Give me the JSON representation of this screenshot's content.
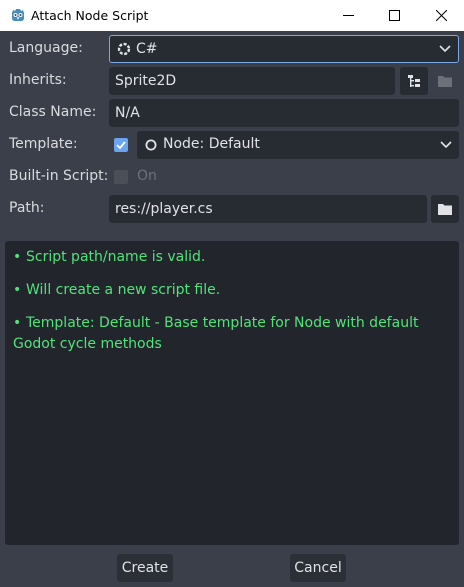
{
  "window": {
    "title": "Attach Node Script",
    "icon": "godot-icon",
    "controls": [
      "minimize-icon",
      "maximize-icon",
      "close-icon"
    ]
  },
  "form": {
    "language": {
      "label": "Language:",
      "value": "C#",
      "icon": "csharp-icon"
    },
    "inherits": {
      "label": "Inherits:",
      "value": "Sprite2D"
    },
    "class_name": {
      "label": "Class Name:",
      "value": "N/A"
    },
    "template": {
      "label": "Template:",
      "checked": true,
      "value": "Node: Default"
    },
    "builtin": {
      "label": "Built-in Script:",
      "checked": false,
      "disabled": true,
      "value": "On"
    },
    "path": {
      "label": "Path:",
      "value": "res://player.cs"
    }
  },
  "messages": [
    "Script path/name is valid.",
    "Will create a new script file.",
    "Template: Default - Base template for Node with default Godot cycle methods"
  ],
  "buttons": {
    "create": "Create",
    "cancel": "Cancel"
  },
  "colors": {
    "background": "#3a3f49",
    "field": "#272b32",
    "accent": "#6aa5f2",
    "message": "#52e37a"
  }
}
